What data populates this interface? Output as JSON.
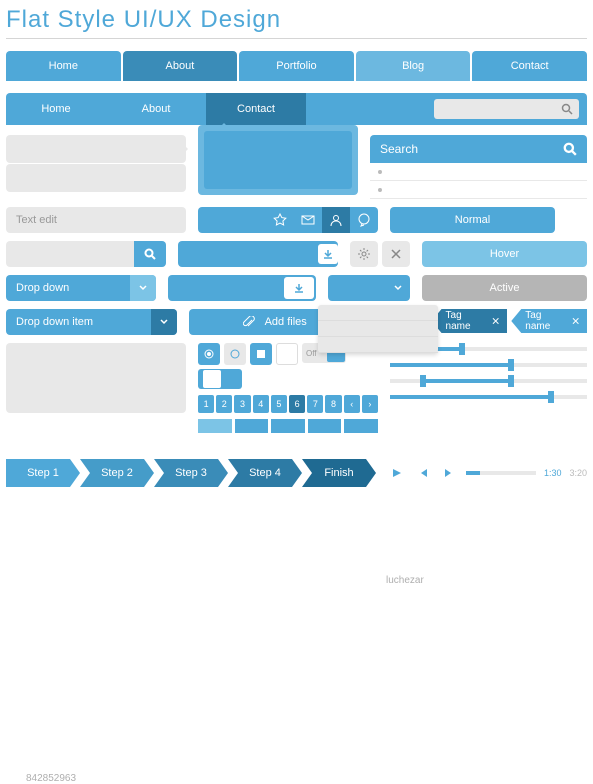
{
  "title": "Flat Style UI/UX Design",
  "nav1": {
    "items": [
      "Home",
      "About",
      "Portfolio",
      "Blog",
      "Contact"
    ],
    "active": 1
  },
  "nav2": {
    "items": [
      "Home",
      "About",
      "Contact"
    ],
    "active": 2,
    "search_placeholder": ""
  },
  "search_card": {
    "label": "Search"
  },
  "text_edit": {
    "placeholder": "Text edit"
  },
  "states": {
    "normal": "Normal",
    "hover": "Hover",
    "active": "Active"
  },
  "dropdown": {
    "label": "Drop down",
    "item": "Drop down item"
  },
  "add_files": {
    "label": "Add files"
  },
  "tags": {
    "name": "Tag name"
  },
  "toggle": {
    "off": "Off",
    "on": ""
  },
  "pagination": {
    "pages": [
      "1",
      "2",
      "3",
      "4",
      "5",
      "6",
      "7",
      "8"
    ],
    "active": 6
  },
  "steps": {
    "items": [
      "Step 1",
      "Step 2",
      "Step 3",
      "Step 4",
      "Finish"
    ]
  },
  "player": {
    "current": "1:30",
    "total": "3:20"
  },
  "watermarks": {
    "a": "luchezar",
    "b": "842852963"
  }
}
